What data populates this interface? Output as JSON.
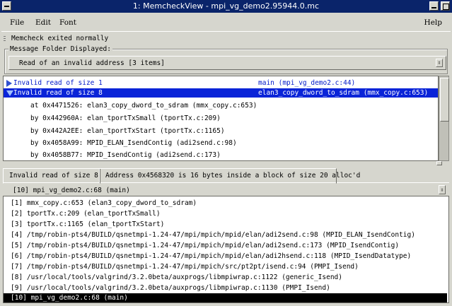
{
  "window": {
    "title": "1: MemcheckView - mpi_vg_demo2.95944.0.mc"
  },
  "menu": {
    "file": "File",
    "edit": "Edit",
    "font": "Font",
    "help": "Help"
  },
  "status": {
    "text": "Memcheck exited normally"
  },
  "folder": {
    "label": "Message Folder Displayed:",
    "selected": "Read of an invalid address  [3 items]"
  },
  "tree": {
    "rows": [
      {
        "text": "Invalid read of size 1",
        "location": "main (mpi_vg_demo2.c:44)"
      },
      {
        "text": "Invalid read of size 8",
        "location": "elan3_copy_dword_to_sdram (mmx_copy.c:653)"
      },
      {
        "text": "at 0x4471526: elan3_copy_dword_to_sdram (mmx_copy.c:653)"
      },
      {
        "text": "by 0x442960A: elan_tportTxSmall (tportTx.c:209)"
      },
      {
        "text": "by 0x442A2EE: elan_tportTxStart (tportTx.c:1165)"
      },
      {
        "text": "by 0x4058A99: MPID_ELAN_IsendContig (adi2send.c:98)"
      },
      {
        "text": "by 0x4058B77: MPID_IsendContig (adi2send.c:173)"
      }
    ]
  },
  "tabs": [
    "Invalid read of size 8",
    "Address 0x4568320 is 16 bytes inside a block of size 20 alloc'd"
  ],
  "frame_select": {
    "value": "[10]  mpi_vg_demo2.c:68 (main)"
  },
  "stack": [
    "[1]  mmx_copy.c:653 (elan3_copy_dword_to_sdram)",
    "[2]  tportTx.c:209 (elan_tportTxSmall)",
    "[3]  tportTx.c:1165 (elan_tportTxStart)",
    "[4]  /tmp/robin-pts4/BUILD/qsnetmpi-1.24-47/mpi/mpich/mpid/elan/adi2send.c:98 (MPID_ELAN_IsendContig)",
    "[5]  /tmp/robin-pts4/BUILD/qsnetmpi-1.24-47/mpi/mpich/mpid/elan/adi2send.c:173 (MPID_IsendContig)",
    "[6]  /tmp/robin-pts4/BUILD/qsnetmpi-1.24-47/mpi/mpich/mpid/elan/adi2hsend.c:118 (MPID_IsendDatatype)",
    "[7]  /tmp/robin-pts4/BUILD/qsnetmpi-1.24-47/mpi/mpich/src/pt2pt/isend.c:94 (PMPI_Isend)",
    "[8]  /usr/local/tools/valgrind/3.2.0beta/auxprogs/libmpiwrap.c:1122 (generic_Isend)",
    "[9]  /usr/local/tools/valgrind/3.2.0beta/auxprogs/libmpiwrap.c:1130 (PMPI_Isend)",
    "[10]  mpi_vg_demo2.c:68 (main)"
  ],
  "colors": {
    "titlebar": "#0a246a",
    "selection": "#0a24d8",
    "link": "#0018c8"
  }
}
